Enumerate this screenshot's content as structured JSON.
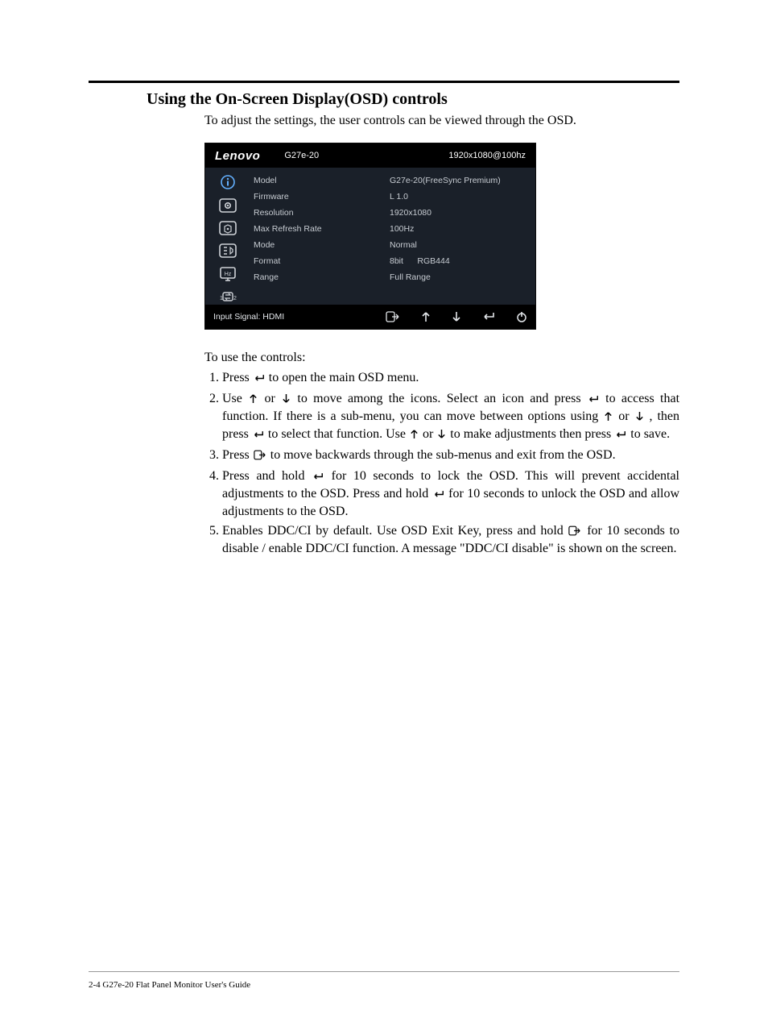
{
  "section_title": "Using the On-Screen Display(OSD) controls",
  "intro_text": "To adjust the settings, the user controls can be viewed through the OSD.",
  "osd": {
    "brand": "Lenovo",
    "model_header": "G27e-20",
    "resolution_header": "1920x1080@100hz",
    "row_labels": [
      "Model",
      "Firmware",
      "Resolution",
      "Max Refresh Rate",
      "Mode",
      "Format",
      "Range"
    ],
    "row_values": [
      "G27e-20(FreeSync Premium)",
      "L 1.0",
      "1920x1080",
      "100Hz",
      "Normal",
      "8bit      RGB444",
      "Full Range"
    ],
    "input_signal": "Input Signal: HDMI"
  },
  "controls_intro": "To use the controls:",
  "steps": {
    "s1_a": "Press ",
    "s1_b": " to open the main OSD menu.",
    "s2_a": "Use ",
    "s2_b": " or ",
    "s2_c": " to move among the icons. Select an icon and press  ",
    "s2_d": " to access that function. If there is a sub-menu, you can move between options using ",
    "s2_e": " or ",
    "s2_f": " ,   then press ",
    "s2_g": " to select that function. Use ",
    "s2_h": " or ",
    "s2_i": " to make adjustments then press ",
    "s2_j": " to save.",
    "s3_a": "Press ",
    "s3_b": " to move backwards through the sub-menus and exit from the OSD.",
    "s4_a": "Press and hold ",
    "s4_b": " for 10 seconds to lock the OSD. This will prevent accidental adjustments to the OSD. Press and hold  ",
    "s4_c": " for 10 seconds to unlock the OSD and allow adjustments to the OSD.",
    "s5_a": "Enables DDC/CI by default. Use OSD Exit Key, press and hold ",
    "s5_b": " for 10 seconds to disable / enable DDC/CI function. A message \"DDC/CI disable\" is shown on the screen."
  },
  "footer": "2-4  G27e-20 Flat Panel Monitor User's Guide"
}
